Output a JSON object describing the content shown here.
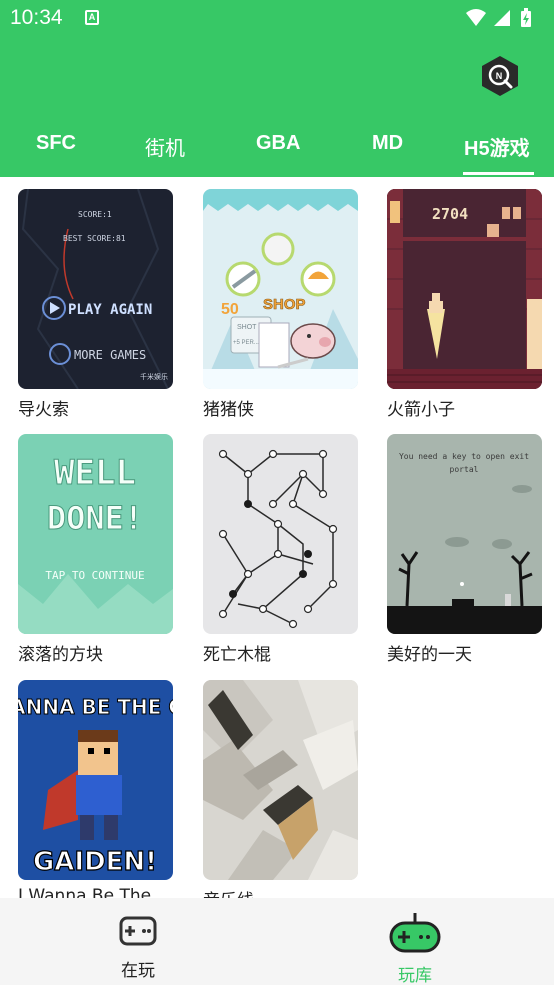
{
  "status_bar": {
    "time": "10:34",
    "notification_icon_letter": "A",
    "icons": [
      "wifi-icon",
      "signal-icon",
      "battery-charging-icon"
    ]
  },
  "header": {
    "search_icon": "search-icon",
    "badge_letter": "N"
  },
  "tabs": [
    {
      "label": "SFC",
      "selected": false
    },
    {
      "label": "街机",
      "selected": false
    },
    {
      "label": "GBA",
      "selected": false
    },
    {
      "label": "MD",
      "selected": false
    },
    {
      "label": "H5游戏",
      "selected": true
    }
  ],
  "games": [
    {
      "name": "导火索",
      "art": {
        "score_line": "SCORE:1",
        "best_line": "BEST SCORE:81",
        "play_label": "PLAY AGAIN",
        "more_label": "MORE GAMES",
        "watermark": "千米娱乐"
      }
    },
    {
      "name": "猪猪侠",
      "art": {
        "left_num": "50",
        "shop_label": "SHOP",
        "panel_line_1": "SHOT",
        "panel_line_2": "+5 PER..."
      }
    },
    {
      "name": "火箭小子",
      "art": {
        "score": "2704"
      }
    },
    {
      "name": "滚落的方块",
      "art": {
        "line_1": "WELL",
        "line_2": "DONE!",
        "line_3": "TAP TO CONTINUE"
      }
    },
    {
      "name": "死亡木棍",
      "art": {}
    },
    {
      "name": "美好的一天",
      "art": {
        "hint_line_1": "You need a key to open exit",
        "hint_line_2": "portal"
      }
    },
    {
      "name": "I Wanna Be The",
      "art": {
        "top_text": "WANNA BE THE GU",
        "bottom_text": "GAIDEN!"
      }
    },
    {
      "name": "音乐线",
      "art": {}
    }
  ],
  "bottom_nav": [
    {
      "label": "在玩",
      "icon": "gamepad-icon",
      "active": false,
      "color": "#222222"
    },
    {
      "label": "玩库",
      "icon": "gamepad-library-icon",
      "active": true,
      "color": "#37c866"
    }
  ],
  "colors": {
    "accent": "#37c866",
    "nav_bg": "#f5f5f5"
  }
}
